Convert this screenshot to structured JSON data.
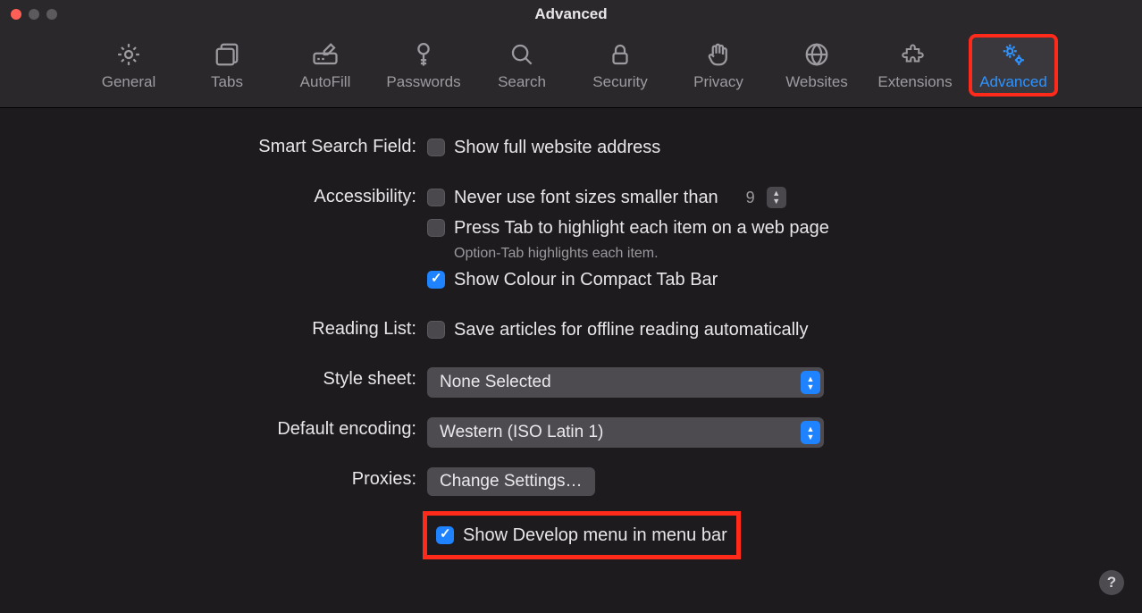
{
  "window": {
    "title": "Advanced"
  },
  "toolbar": {
    "items": [
      {
        "label": "General"
      },
      {
        "label": "Tabs"
      },
      {
        "label": "AutoFill"
      },
      {
        "label": "Passwords"
      },
      {
        "label": "Search"
      },
      {
        "label": "Security"
      },
      {
        "label": "Privacy"
      },
      {
        "label": "Websites"
      },
      {
        "label": "Extensions"
      },
      {
        "label": "Advanced"
      }
    ],
    "active_index": 9
  },
  "sections": {
    "smart_search": {
      "label": "Smart Search Field:",
      "show_full_url": {
        "label": "Show full website address",
        "checked": false
      }
    },
    "accessibility": {
      "label": "Accessibility:",
      "min_font": {
        "label": "Never use font sizes smaller than",
        "checked": false,
        "value": "9"
      },
      "press_tab": {
        "label": "Press Tab to highlight each item on a web page",
        "checked": false,
        "helper": "Option-Tab highlights each item."
      },
      "compact_colour": {
        "label": "Show Colour in Compact Tab Bar",
        "checked": true
      }
    },
    "reading_list": {
      "label": "Reading List:",
      "offline": {
        "label": "Save articles for offline reading automatically",
        "checked": false
      }
    },
    "style_sheet": {
      "label": "Style sheet:",
      "value": "None Selected"
    },
    "default_encoding": {
      "label": "Default encoding:",
      "value": "Western (ISO Latin 1)"
    },
    "proxies": {
      "label": "Proxies:",
      "button": "Change Settings…"
    },
    "develop": {
      "label": "Show Develop menu in menu bar",
      "checked": true
    }
  },
  "help": "?"
}
